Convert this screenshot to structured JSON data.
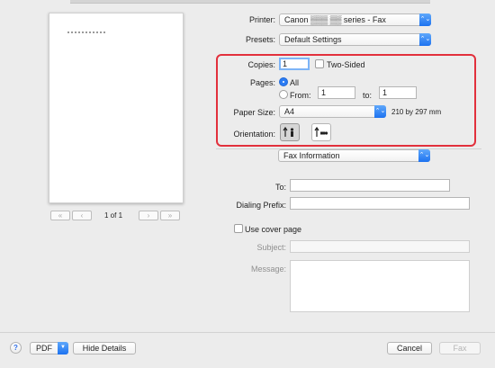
{
  "preview": {
    "page_counter": "1 of 1",
    "first_page": "«",
    "prev_page": "‹",
    "next_page": "›",
    "last_page": "»"
  },
  "printer": {
    "label": "Printer:",
    "value": "Canon ▒▒▒ ▒▒ series - Fax"
  },
  "presets": {
    "label": "Presets:",
    "value": "Default Settings"
  },
  "copies": {
    "label": "Copies:",
    "value": "1",
    "two_sided_label": "Two-Sided"
  },
  "pages": {
    "label": "Pages:",
    "all_label": "All",
    "from_label": "From:",
    "from_value": "1",
    "to_label": "to:",
    "to_value": "1"
  },
  "paper_size": {
    "label": "Paper Size:",
    "value": "A4",
    "dimensions": "210 by 297 mm"
  },
  "orientation": {
    "label": "Orientation:"
  },
  "section_popup": {
    "value": "Fax Information"
  },
  "fax": {
    "to_label": "To:",
    "to_value": "",
    "dialing_prefix_label": "Dialing Prefix:",
    "dialing_prefix_value": "",
    "use_cover_label": "Use cover page",
    "subject_label": "Subject:",
    "message_label": "Message:"
  },
  "footer": {
    "help": "?",
    "pdf": "PDF",
    "hide_details": "Hide Details",
    "cancel": "Cancel",
    "fax": "Fax"
  },
  "colors": {
    "accent": "#2b7cf3",
    "highlight_box": "#e2303c",
    "window_bg": "#ececec"
  },
  "icons": {
    "orientation_portrait": "portrait-person-icon",
    "orientation_landscape": "landscape-person-icon",
    "popup_arrows": "updown-chevron-icon"
  }
}
